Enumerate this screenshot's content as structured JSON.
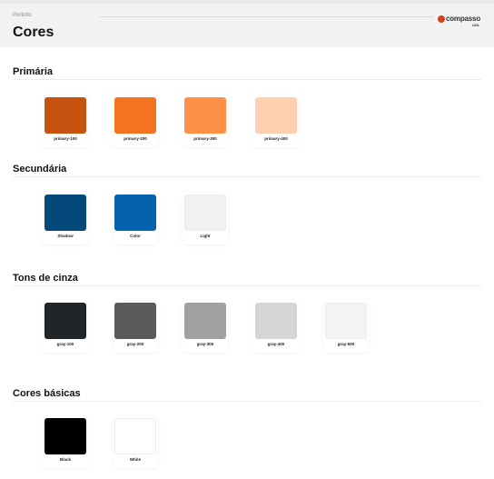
{
  "header": {
    "breadcrumb": "Portinfo",
    "title": "Cores",
    "logo_text": "compasso",
    "logo_sub": "UOL"
  },
  "sections": [
    {
      "title": "Primária",
      "swatches": [
        {
          "label": "primary-100",
          "color": "#C7510F"
        },
        {
          "label": "primary-200",
          "color": "#F47321"
        },
        {
          "label": "primary-300",
          "color": "#FF9147"
        },
        {
          "label": "primary-400",
          "color": "#FFCFB0"
        }
      ]
    },
    {
      "title": "Secundária",
      "swatches": [
        {
          "label": "Shadow",
          "color": "#05497A"
        },
        {
          "label": "Color",
          "color": "#0463AC"
        },
        {
          "label": "Light",
          "color": "#F1F1F1"
        }
      ]
    },
    {
      "title": "Tons de cinza",
      "swatches": [
        {
          "label": "gray-100",
          "color": "#222528"
        },
        {
          "label": "gray-200",
          "color": "#5B5B5B"
        },
        {
          "label": "gray-300",
          "color": "#A0A1A3"
        },
        {
          "label": "gray-400",
          "color": "#D6D6D6"
        },
        {
          "label": "gray-500",
          "color": "#F3F3F3"
        }
      ]
    },
    {
      "title": "Cores básicas",
      "swatches": [
        {
          "label": "Black",
          "color": "#000000"
        },
        {
          "label": "White",
          "color": "#FFFFFF"
        }
      ]
    }
  ]
}
